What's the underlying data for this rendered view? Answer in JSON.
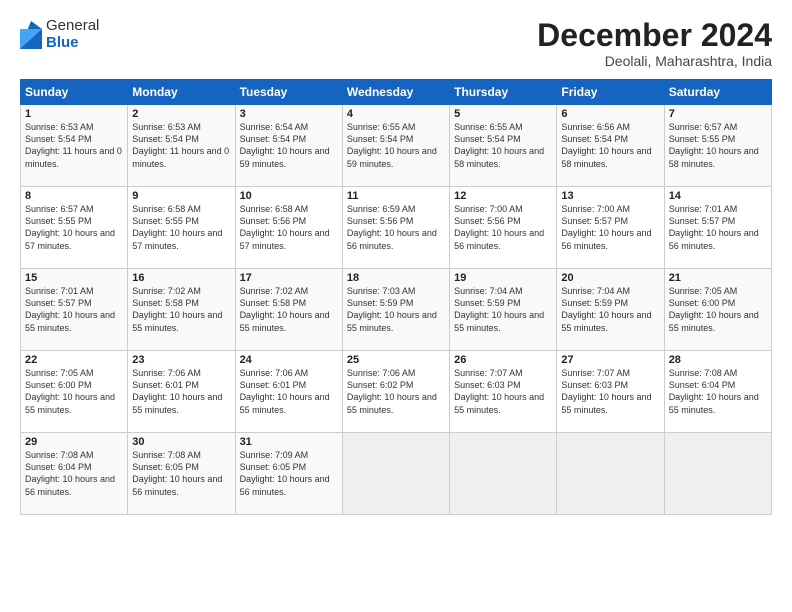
{
  "logo": {
    "general": "General",
    "blue": "Blue"
  },
  "title": "December 2024",
  "location": "Deolali, Maharashtra, India",
  "days_of_week": [
    "Sunday",
    "Monday",
    "Tuesday",
    "Wednesday",
    "Thursday",
    "Friday",
    "Saturday"
  ],
  "weeks": [
    [
      {
        "day": "1",
        "sunrise": "6:53 AM",
        "sunset": "5:54 PM",
        "daylight": "11 hours and 0 minutes."
      },
      {
        "day": "2",
        "sunrise": "6:53 AM",
        "sunset": "5:54 PM",
        "daylight": "11 hours and 0 minutes."
      },
      {
        "day": "3",
        "sunrise": "6:54 AM",
        "sunset": "5:54 PM",
        "daylight": "10 hours and 59 minutes."
      },
      {
        "day": "4",
        "sunrise": "6:55 AM",
        "sunset": "5:54 PM",
        "daylight": "10 hours and 59 minutes."
      },
      {
        "day": "5",
        "sunrise": "6:55 AM",
        "sunset": "5:54 PM",
        "daylight": "10 hours and 58 minutes."
      },
      {
        "day": "6",
        "sunrise": "6:56 AM",
        "sunset": "5:54 PM",
        "daylight": "10 hours and 58 minutes."
      },
      {
        "day": "7",
        "sunrise": "6:57 AM",
        "sunset": "5:55 PM",
        "daylight": "10 hours and 58 minutes."
      }
    ],
    [
      {
        "day": "8",
        "sunrise": "6:57 AM",
        "sunset": "5:55 PM",
        "daylight": "10 hours and 57 minutes."
      },
      {
        "day": "9",
        "sunrise": "6:58 AM",
        "sunset": "5:55 PM",
        "daylight": "10 hours and 57 minutes."
      },
      {
        "day": "10",
        "sunrise": "6:58 AM",
        "sunset": "5:56 PM",
        "daylight": "10 hours and 57 minutes."
      },
      {
        "day": "11",
        "sunrise": "6:59 AM",
        "sunset": "5:56 PM",
        "daylight": "10 hours and 56 minutes."
      },
      {
        "day": "12",
        "sunrise": "7:00 AM",
        "sunset": "5:56 PM",
        "daylight": "10 hours and 56 minutes."
      },
      {
        "day": "13",
        "sunrise": "7:00 AM",
        "sunset": "5:57 PM",
        "daylight": "10 hours and 56 minutes."
      },
      {
        "day": "14",
        "sunrise": "7:01 AM",
        "sunset": "5:57 PM",
        "daylight": "10 hours and 56 minutes."
      }
    ],
    [
      {
        "day": "15",
        "sunrise": "7:01 AM",
        "sunset": "5:57 PM",
        "daylight": "10 hours and 55 minutes."
      },
      {
        "day": "16",
        "sunrise": "7:02 AM",
        "sunset": "5:58 PM",
        "daylight": "10 hours and 55 minutes."
      },
      {
        "day": "17",
        "sunrise": "7:02 AM",
        "sunset": "5:58 PM",
        "daylight": "10 hours and 55 minutes."
      },
      {
        "day": "18",
        "sunrise": "7:03 AM",
        "sunset": "5:59 PM",
        "daylight": "10 hours and 55 minutes."
      },
      {
        "day": "19",
        "sunrise": "7:04 AM",
        "sunset": "5:59 PM",
        "daylight": "10 hours and 55 minutes."
      },
      {
        "day": "20",
        "sunrise": "7:04 AM",
        "sunset": "5:59 PM",
        "daylight": "10 hours and 55 minutes."
      },
      {
        "day": "21",
        "sunrise": "7:05 AM",
        "sunset": "6:00 PM",
        "daylight": "10 hours and 55 minutes."
      }
    ],
    [
      {
        "day": "22",
        "sunrise": "7:05 AM",
        "sunset": "6:00 PM",
        "daylight": "10 hours and 55 minutes."
      },
      {
        "day": "23",
        "sunrise": "7:06 AM",
        "sunset": "6:01 PM",
        "daylight": "10 hours and 55 minutes."
      },
      {
        "day": "24",
        "sunrise": "7:06 AM",
        "sunset": "6:01 PM",
        "daylight": "10 hours and 55 minutes."
      },
      {
        "day": "25",
        "sunrise": "7:06 AM",
        "sunset": "6:02 PM",
        "daylight": "10 hours and 55 minutes."
      },
      {
        "day": "26",
        "sunrise": "7:07 AM",
        "sunset": "6:03 PM",
        "daylight": "10 hours and 55 minutes."
      },
      {
        "day": "27",
        "sunrise": "7:07 AM",
        "sunset": "6:03 PM",
        "daylight": "10 hours and 55 minutes."
      },
      {
        "day": "28",
        "sunrise": "7:08 AM",
        "sunset": "6:04 PM",
        "daylight": "10 hours and 55 minutes."
      }
    ],
    [
      {
        "day": "29",
        "sunrise": "7:08 AM",
        "sunset": "6:04 PM",
        "daylight": "10 hours and 56 minutes."
      },
      {
        "day": "30",
        "sunrise": "7:08 AM",
        "sunset": "6:05 PM",
        "daylight": "10 hours and 56 minutes."
      },
      {
        "day": "31",
        "sunrise": "7:09 AM",
        "sunset": "6:05 PM",
        "daylight": "10 hours and 56 minutes."
      },
      null,
      null,
      null,
      null
    ]
  ],
  "labels": {
    "sunrise": "Sunrise:",
    "sunset": "Sunset:",
    "daylight": "Daylight:"
  }
}
